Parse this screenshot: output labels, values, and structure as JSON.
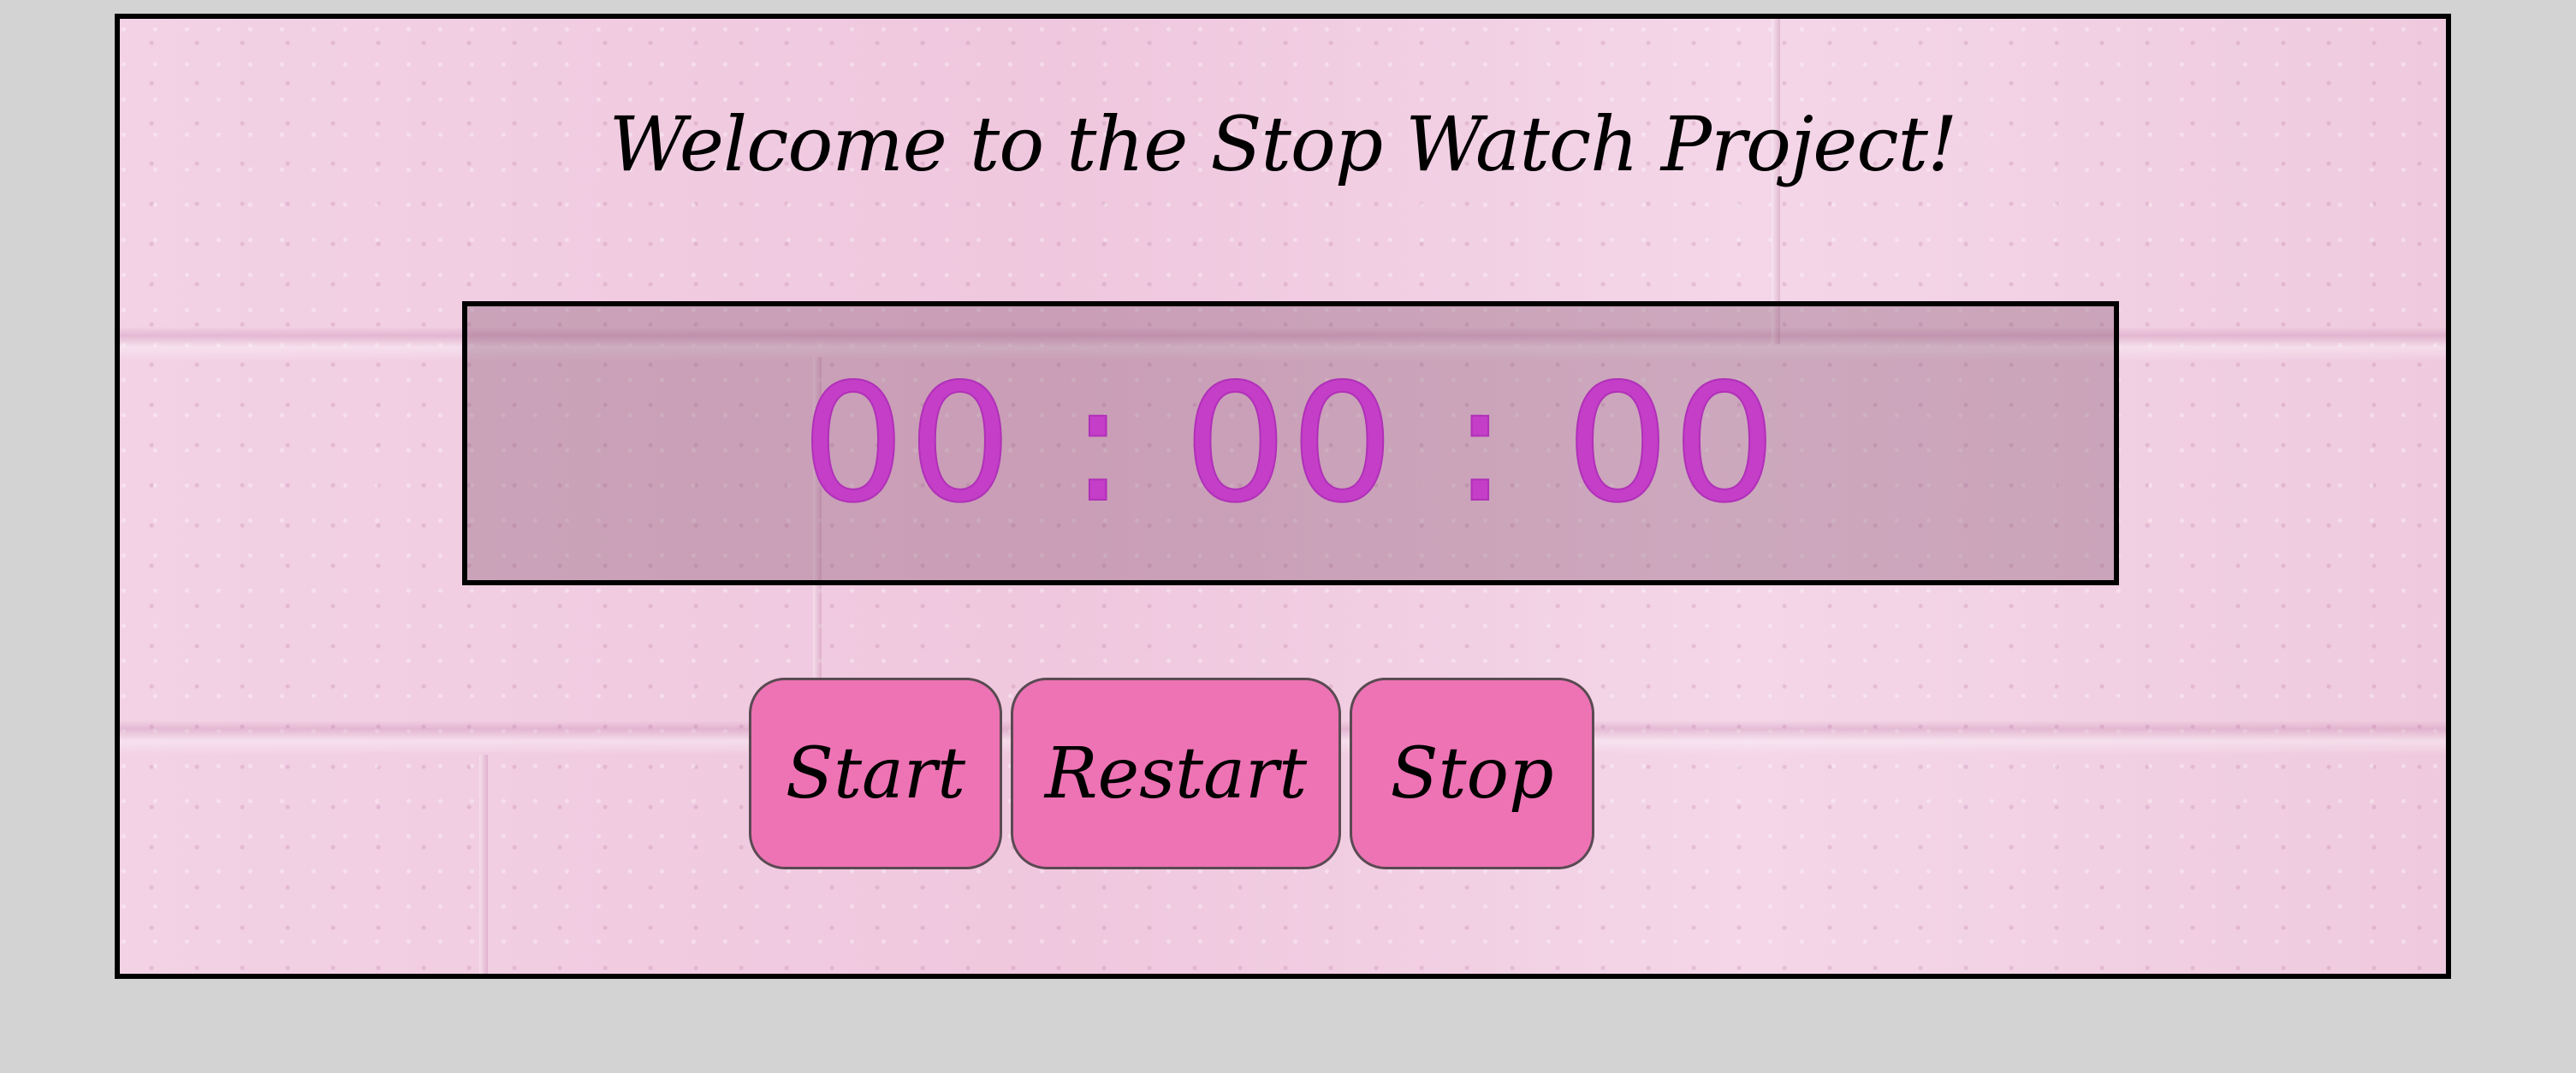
{
  "page": {
    "title": "Welcome to the Stop Watch Project!"
  },
  "stopwatch": {
    "time": "00 : 00 : 00",
    "color": "#c43ec8"
  },
  "controls": {
    "start_label": "Start",
    "restart_label": "Restart",
    "stop_label": "Stop",
    "button_color": "#ed73b4"
  },
  "theme": {
    "page_background": "#d3d3d3",
    "panel_background": "#f2cde2"
  }
}
